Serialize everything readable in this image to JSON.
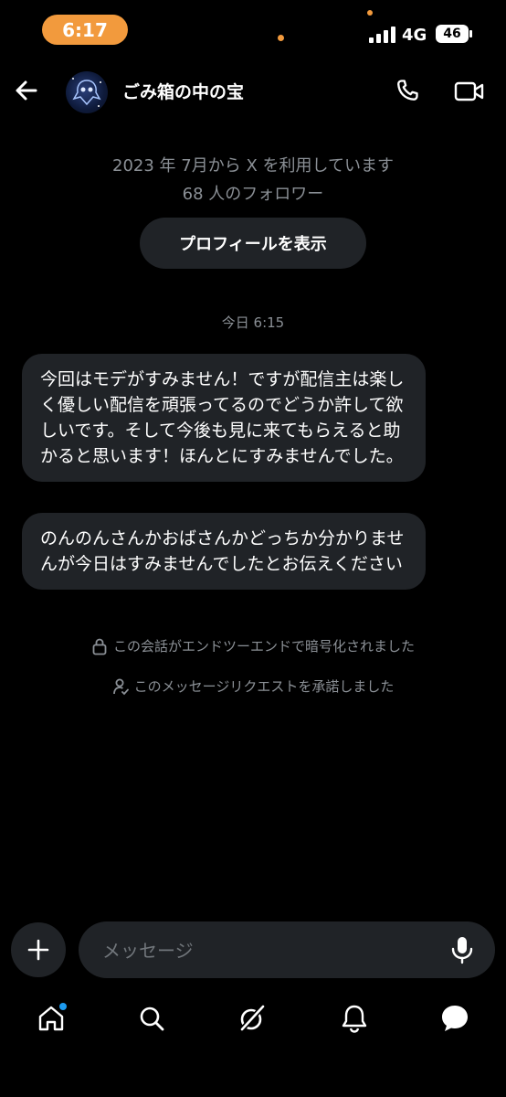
{
  "status_bar": {
    "time": "6:17",
    "network": "4G",
    "battery": "46"
  },
  "header": {
    "title": "ごみ箱の中の宝"
  },
  "intro": {
    "joined": "2023 年 7月から X を利用しています",
    "followers": "68 人のフォロワー",
    "profile_button": "プロフィールを表示"
  },
  "thread": {
    "timestamp": "今日 6:15",
    "messages": [
      "今回はモデがすみません！ですが配信主は楽しく優しい配信を頑張ってるのでどうか許して欲しいです。そして今後も見に来てもらえると助かると思います！ほんとにすみませんでした。",
      "のんのんさんかおばさんかどっちか分かりませんが今日はすみませんでしたとお伝えください"
    ],
    "system_notes": [
      "この会話がエンドツーエンドで暗号化されました",
      "このメッセージリクエストを承諾しました"
    ]
  },
  "composer": {
    "placeholder": "メッセージ"
  },
  "colors": {
    "accent": "#1d9bf0",
    "status_orange": "#f29a3d",
    "bubble": "#202327"
  },
  "icons": [
    "back-arrow-icon",
    "phone-icon",
    "video-icon",
    "lock-icon",
    "person-check-icon",
    "plus-icon",
    "mic-icon",
    "home-icon",
    "search-icon",
    "grok-icon",
    "bell-icon",
    "messages-icon"
  ]
}
